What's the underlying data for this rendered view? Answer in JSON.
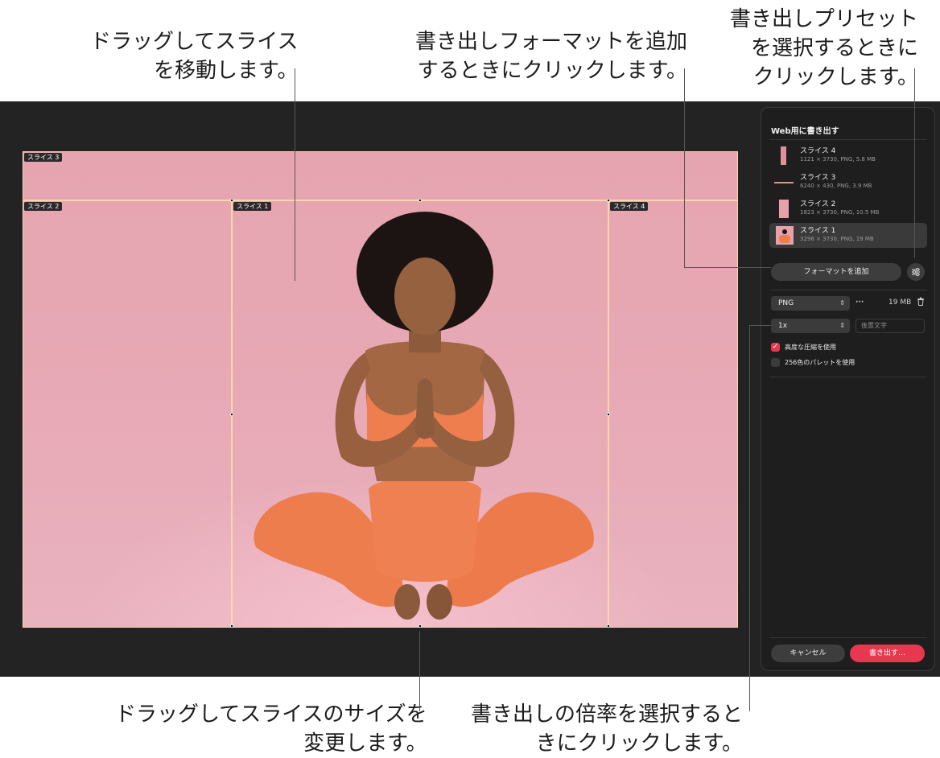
{
  "callouts": {
    "move_slice": [
      "ドラッグしてスライス",
      "を移動します。"
    ],
    "add_format": [
      "書き出しフォーマットを追加",
      "するときにクリックします。"
    ],
    "preset": [
      "書き出しプリセット",
      "を選択するときに",
      "クリックします。"
    ],
    "resize_slice": [
      "ドラッグしてスライスのサイズを",
      "変更します。"
    ],
    "scale": [
      "書き出しの倍率を選択すると",
      "きにクリックします。"
    ]
  },
  "canvas": {
    "slice_tags": [
      "スライス 3",
      "スライス 2",
      "スライス 1",
      "スライス 4"
    ]
  },
  "panel": {
    "title": "Web用に書き出す",
    "slices": [
      {
        "name": "スライス 4",
        "meta": "1121 × 3730, PNG, 5.8 MB"
      },
      {
        "name": "スライス 3",
        "meta": "6240 × 430, PNG, 3.9 MB"
      },
      {
        "name": "スライス 2",
        "meta": "1823 × 3730, PNG, 10.5 MB"
      },
      {
        "name": "スライス 1",
        "meta": "3296 × 3730, PNG, 19 MB"
      }
    ],
    "add_format_label": "フォーマットを追加",
    "format": {
      "type": "PNG",
      "more": "···",
      "size": "19 MB",
      "scale": "1x",
      "suffix_placeholder": "後置文字"
    },
    "options": {
      "advanced_compression": "高度な圧縮を使用",
      "palette_256": "256色のパレットを使用"
    },
    "cancel_label": "キャンセル",
    "export_label": "書き出す…"
  },
  "colors": {
    "accent": "#e8384f",
    "backdrop": "#e6a7b3",
    "outfit": "#ee7d4e"
  }
}
